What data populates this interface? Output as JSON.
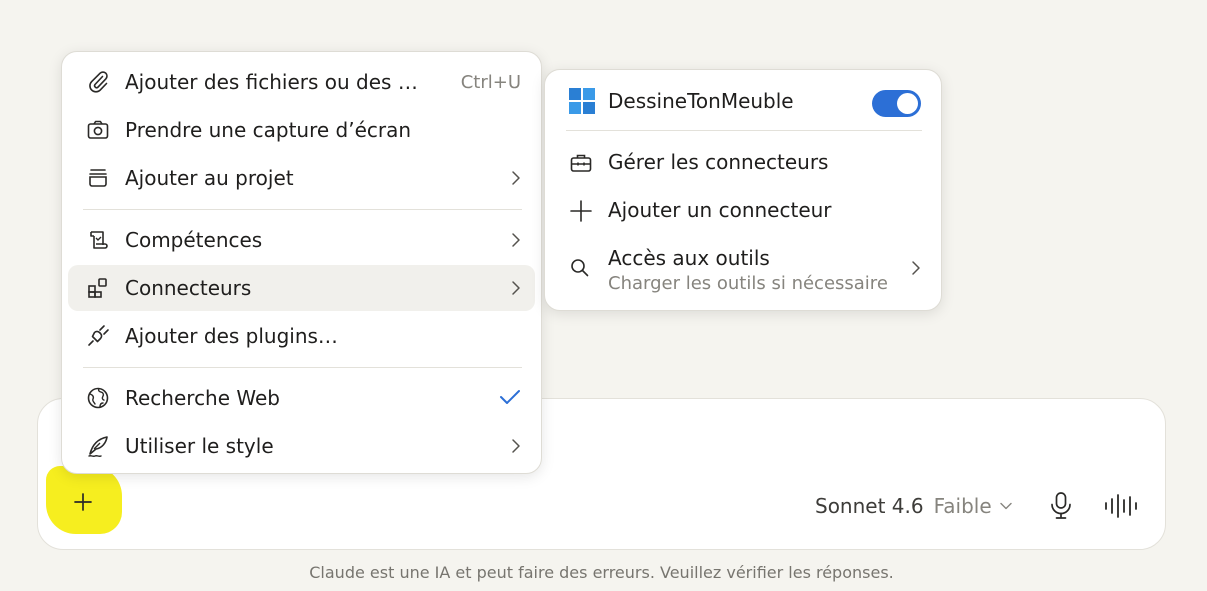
{
  "main_menu": {
    "items": [
      {
        "label": "Ajouter des fichiers ou des …",
        "shortcut": "Ctrl+U",
        "icon": "paperclip-icon"
      },
      {
        "label": "Prendre une capture d’écran",
        "icon": "camera-icon"
      },
      {
        "label": "Ajouter au projet",
        "icon": "project-box-icon"
      },
      {
        "label": "Compétences",
        "icon": "scroll-icon"
      },
      {
        "label": "Connecteurs",
        "icon": "connectors-grid-icon"
      },
      {
        "label": "Ajouter des plugins…",
        "icon": "plug-icon"
      },
      {
        "label": "Recherche Web",
        "icon": "globe-icon",
        "checked": true
      },
      {
        "label": "Utiliser le style",
        "icon": "quill-pen-icon"
      }
    ]
  },
  "connectors_menu": {
    "connector": {
      "name": "DessineTonMeuble",
      "enabled": true,
      "icon": "windows-logo-icon"
    },
    "manage_label": "Gérer les connecteurs",
    "add_label": "Ajouter un connecteur",
    "tool_access": {
      "label": "Accès aux outils",
      "sublabel": "Charger les outils si nécessaire"
    }
  },
  "composer": {
    "model_name": "Sonnet 4.6",
    "effort": "Faible"
  },
  "disclaimer": "Claude est une IA et peut faire des erreurs. Veuillez vérifier les réponses.",
  "colors": {
    "background": "#f5f4ef",
    "accent_blue": "#2c6fd6",
    "highlight_yellow": "#f6ee1f"
  }
}
